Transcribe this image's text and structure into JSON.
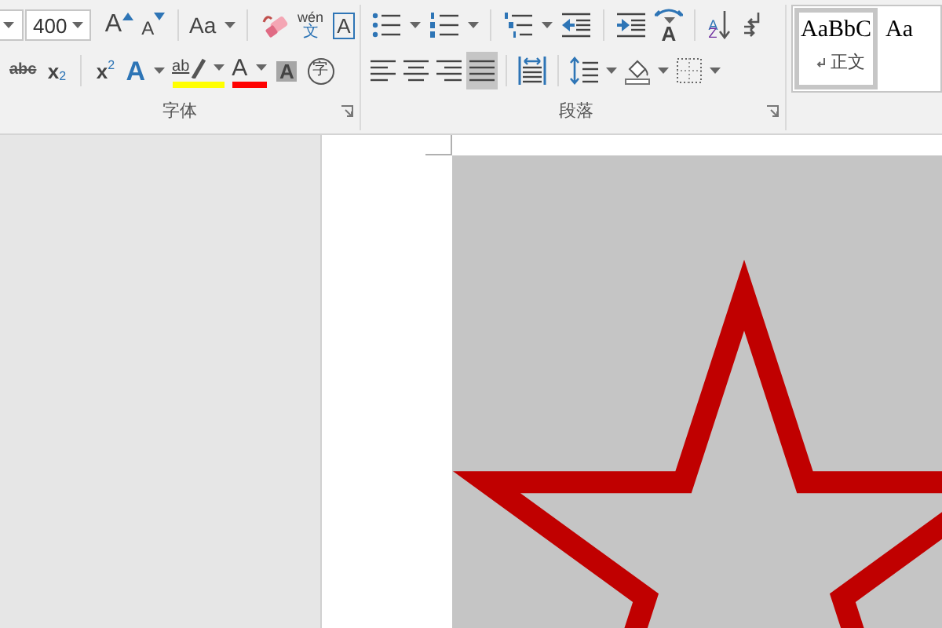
{
  "font_group": {
    "size_value": "400",
    "label": "字体",
    "row1": [
      {
        "kind": "grow-font",
        "glyph": "A",
        "has_menu": false
      },
      {
        "kind": "shrink-font",
        "glyph": "A",
        "has_menu": false
      },
      {
        "kind": "change-case",
        "glyph": "Aa",
        "has_menu": true
      },
      {
        "kind": "clear-format",
        "has_menu": false
      },
      {
        "kind": "phonetic",
        "glyph": "wén",
        "small": "文",
        "has_menu": false
      },
      {
        "kind": "char-border",
        "glyph": "A",
        "has_menu": false
      }
    ],
    "row2": [
      {
        "kind": "strike",
        "glyph": "abc",
        "has_menu": false
      },
      {
        "kind": "subscript",
        "glyph": "x",
        "small": "2",
        "has_menu": false
      },
      {
        "kind": "superscript",
        "glyph": "x",
        "small": "2",
        "has_menu": false
      },
      {
        "kind": "text-effects",
        "glyph": "A",
        "has_menu": true
      },
      {
        "kind": "highlight",
        "glyph": "ab",
        "color": "#ffff00",
        "has_menu": true
      },
      {
        "kind": "font-color",
        "glyph": "A",
        "color": "#ff0000",
        "has_menu": true
      },
      {
        "kind": "char-shading",
        "glyph": "A",
        "has_menu": false
      },
      {
        "kind": "enclosed",
        "glyph": "字",
        "has_menu": false
      }
    ]
  },
  "paragraph_group": {
    "label": "段落",
    "row1": [
      {
        "kind": "bullets",
        "has_menu": true
      },
      {
        "kind": "numbering",
        "has_menu": true
      },
      {
        "kind": "multilevel",
        "has_menu": true
      },
      {
        "kind": "decrease-indent",
        "has_menu": false
      },
      {
        "kind": "increase-indent",
        "has_menu": false
      },
      {
        "kind": "asian-layout",
        "glyph": "A",
        "has_menu": true
      },
      {
        "kind": "sort",
        "glyph": "A",
        "small": "Z",
        "has_menu": false
      },
      {
        "kind": "show-marks",
        "has_menu": false
      }
    ],
    "row2": [
      {
        "kind": "align-left",
        "selected": false,
        "has_menu": false
      },
      {
        "kind": "align-center",
        "selected": false,
        "has_menu": false
      },
      {
        "kind": "align-right",
        "selected": false,
        "has_menu": false
      },
      {
        "kind": "justify",
        "selected": true,
        "has_menu": false
      },
      {
        "kind": "distributed",
        "selected": false,
        "has_menu": false
      },
      {
        "kind": "line-spacing",
        "has_menu": true
      },
      {
        "kind": "shading",
        "has_menu": true
      },
      {
        "kind": "borders",
        "has_menu": true
      }
    ]
  },
  "styles_gallery": {
    "items": [
      {
        "preview": "AaBbC",
        "name": "正文",
        "selected": true
      },
      {
        "preview": "Aa",
        "selected": false
      }
    ]
  }
}
